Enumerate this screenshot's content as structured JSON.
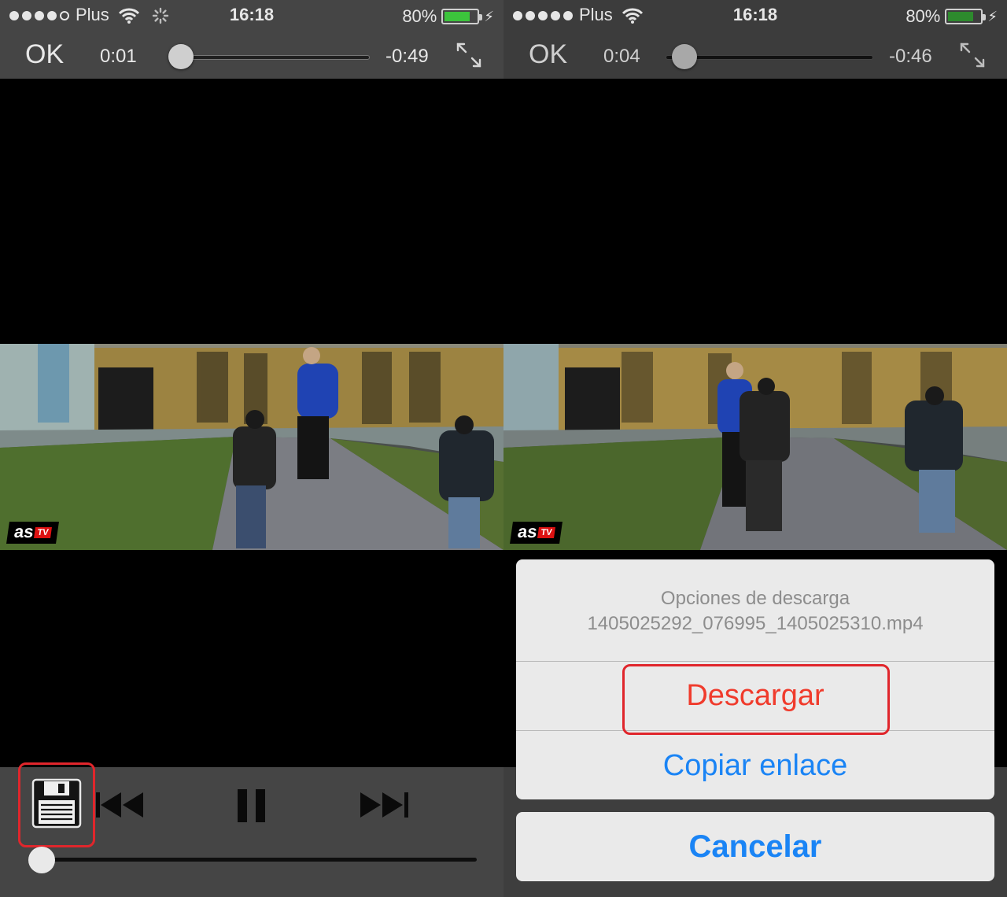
{
  "screens": {
    "left": {
      "status": {
        "carrier": "Plus",
        "time": "16:18",
        "battery": "80%"
      },
      "player": {
        "ok_label": "OK",
        "elapsed": "0:01",
        "remaining": "-0:49",
        "progress": 0.02
      },
      "watermark": {
        "brand": "as",
        "suffix": "TV"
      },
      "bottom_progress": 0.0
    },
    "right": {
      "status": {
        "carrier": "Plus",
        "time": "16:18",
        "battery": "80%"
      },
      "player": {
        "ok_label": "OK",
        "elapsed": "0:04",
        "remaining": "-0:46",
        "progress": 0.08
      },
      "watermark": {
        "brand": "as",
        "suffix": "TV"
      },
      "action_sheet": {
        "title": "Opciones de descarga",
        "filename": "1405025292_076995_1405025310.mp4",
        "download_label": "Descargar",
        "copy_label": "Copiar enlace",
        "cancel_label": "Cancelar"
      }
    }
  },
  "colors": {
    "bar_bg": "#454545",
    "highlight": "#e0262c",
    "destructive": "#f03b2c",
    "link_blue": "#1a84f5",
    "battery_green": "#3cc43c"
  },
  "icons": [
    "wifi-icon",
    "activity-spinner-icon",
    "battery-icon",
    "charging-bolt-icon",
    "expand-icon",
    "floppy-disk-save-icon",
    "skip-back-icon",
    "pause-icon",
    "skip-forward-icon"
  ]
}
